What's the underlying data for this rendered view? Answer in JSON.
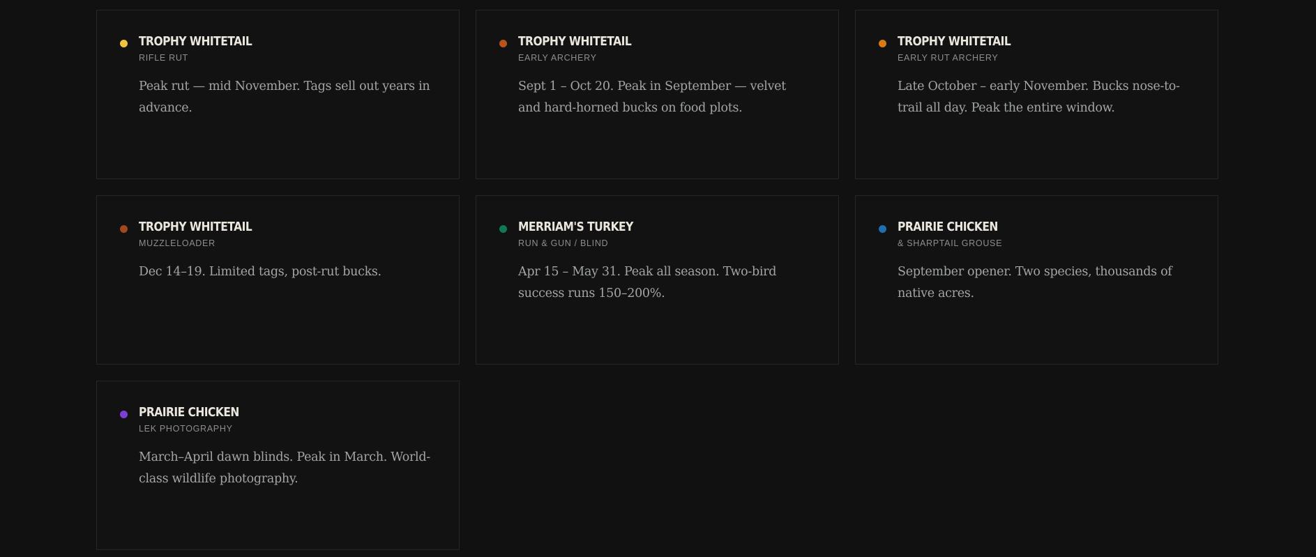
{
  "cards": [
    {
      "title": "TROPHY WHITETAIL",
      "subtitle": "RIFLE RUT",
      "description": "Peak rut — mid November. Tags sell out years in advance.",
      "dot_color": "#f2c43c"
    },
    {
      "title": "TROPHY WHITETAIL",
      "subtitle": "EARLY ARCHERY",
      "description": "Sept 1 – Oct 20. Peak in September — velvet and hard-horned bucks on food plots.",
      "dot_color": "#b8541a"
    },
    {
      "title": "TROPHY WHITETAIL",
      "subtitle": "EARLY RUT ARCHERY",
      "description": "Late October – early November. Bucks nose-to-trail all day. Peak the entire window.",
      "dot_color": "#d97a16"
    },
    {
      "title": "TROPHY WHITETAIL",
      "subtitle": "MUZZLELOADER",
      "description": "Dec 14–19. Limited tags, post-rut bucks.",
      "dot_color": "#a3471c"
    },
    {
      "title": "MERRIAM'S TURKEY",
      "subtitle": "RUN & GUN / BLIND",
      "description": "Apr 15 – May 31. Peak all season. Two-bird success runs 150–200%.",
      "dot_color": "#0e7a55"
    },
    {
      "title": "PRAIRIE CHICKEN",
      "subtitle": "& SHARPTAIL GROUSE",
      "description": "September opener. Two species, thousands of native acres.",
      "dot_color": "#1f6fb0"
    },
    {
      "title": "PRAIRIE CHICKEN",
      "subtitle": "LEK PHOTOGRAPHY",
      "description": "March–April dawn blinds. Peak in March. World-class wildlife photography.",
      "dot_color": "#7b3fd6"
    }
  ]
}
